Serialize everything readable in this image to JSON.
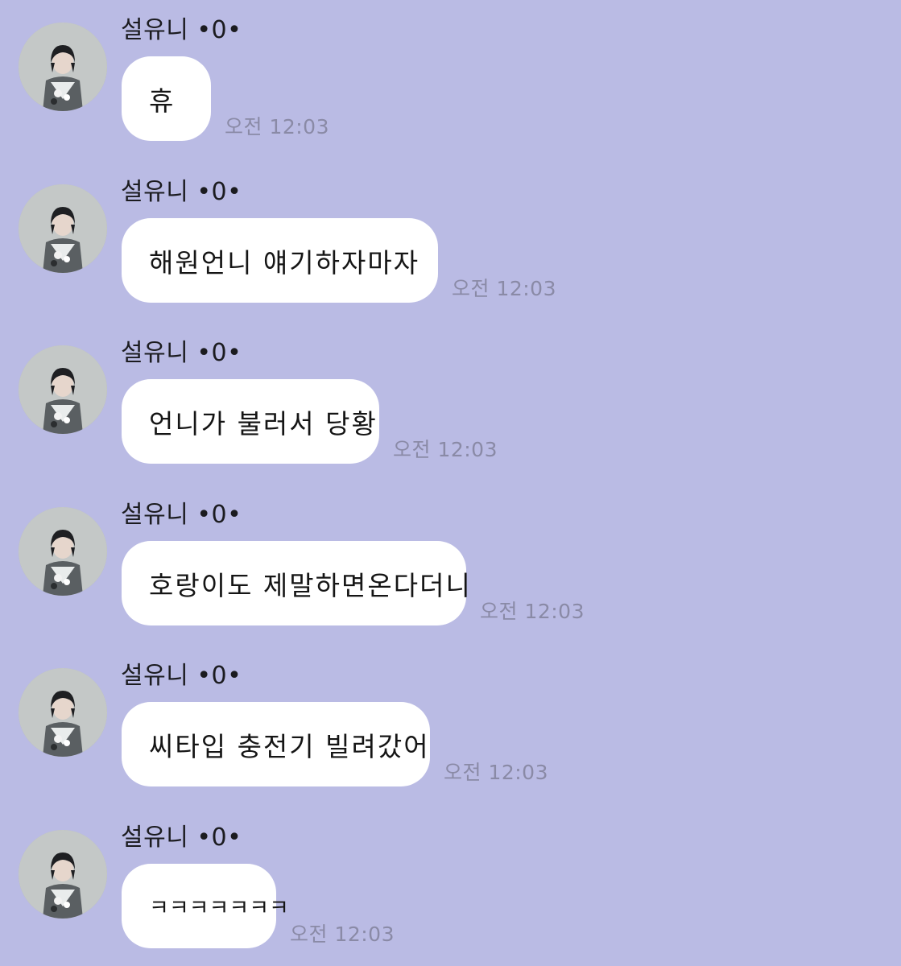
{
  "chat": {
    "messages": [
      {
        "sender": "설유니 •0•",
        "text": "휴",
        "time": "오전 12:03"
      },
      {
        "sender": "설유니 •0•",
        "text": "해원언니 얘기하자마자",
        "time": "오전 12:03"
      },
      {
        "sender": "설유니 •0•",
        "text": "언니가 불러서 당황",
        "time": "오전 12:03"
      },
      {
        "sender": "설유니 •0•",
        "text": "호랑이도 제말하면온다더니",
        "time": "오전 12:03"
      },
      {
        "sender": "설유니 •0•",
        "text": "씨타입 충전기 빌려갔어",
        "time": "오전 12:03"
      },
      {
        "sender": "설유니 •0•",
        "text": "ㅋㅋㅋㅋㅋㅋㅋ",
        "time": "오전 12:03"
      }
    ],
    "avatar_icon": "profile-photo-avatar",
    "colors": {
      "background": "#babbe4",
      "bubble": "#ffffff",
      "time_text": "#8a8aa6"
    }
  }
}
